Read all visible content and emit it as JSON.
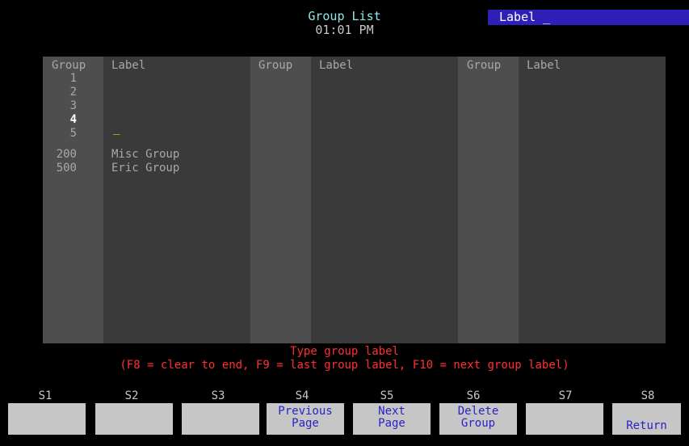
{
  "header": {
    "title": "Group List",
    "time": "01:01 PM",
    "command_line": "Label _"
  },
  "columns": [
    {
      "group_header": "Group",
      "label_header": "Label"
    },
    {
      "group_header": "Group",
      "label_header": "Label"
    },
    {
      "group_header": "Group",
      "label_header": "Label"
    }
  ],
  "groups": [
    {
      "number": "1",
      "label": ""
    },
    {
      "number": "2",
      "label": ""
    },
    {
      "number": "3",
      "label": ""
    },
    {
      "number": "4",
      "label": "_"
    },
    {
      "number": "5",
      "label": ""
    },
    {
      "number": "200",
      "label": "Misc Group"
    },
    {
      "number": "500",
      "label": "Eric Group"
    }
  ],
  "prompt": {
    "line1": "Type group label",
    "line2": "(F8 = clear to end, F9 = last group label, F10 = next group label)"
  },
  "softkeys": [
    {
      "id": "S1",
      "line1": "",
      "line2": ""
    },
    {
      "id": "S2",
      "line1": "",
      "line2": ""
    },
    {
      "id": "S3",
      "line1": "",
      "line2": ""
    },
    {
      "id": "S4",
      "line1": "Previous",
      "line2": "Page"
    },
    {
      "id": "S5",
      "line1": "Next",
      "line2": "Page"
    },
    {
      "id": "S6",
      "line1": "Delete",
      "line2": "Group"
    },
    {
      "id": "S7",
      "line1": "",
      "line2": ""
    },
    {
      "id": "S8",
      "line1": "",
      "line2": "Return"
    }
  ],
  "colors": {
    "title": "#8fe8e8",
    "prompt": "#ff3030",
    "command_bar": "#2f1fb8",
    "softkey_text": "#2a22c8"
  }
}
